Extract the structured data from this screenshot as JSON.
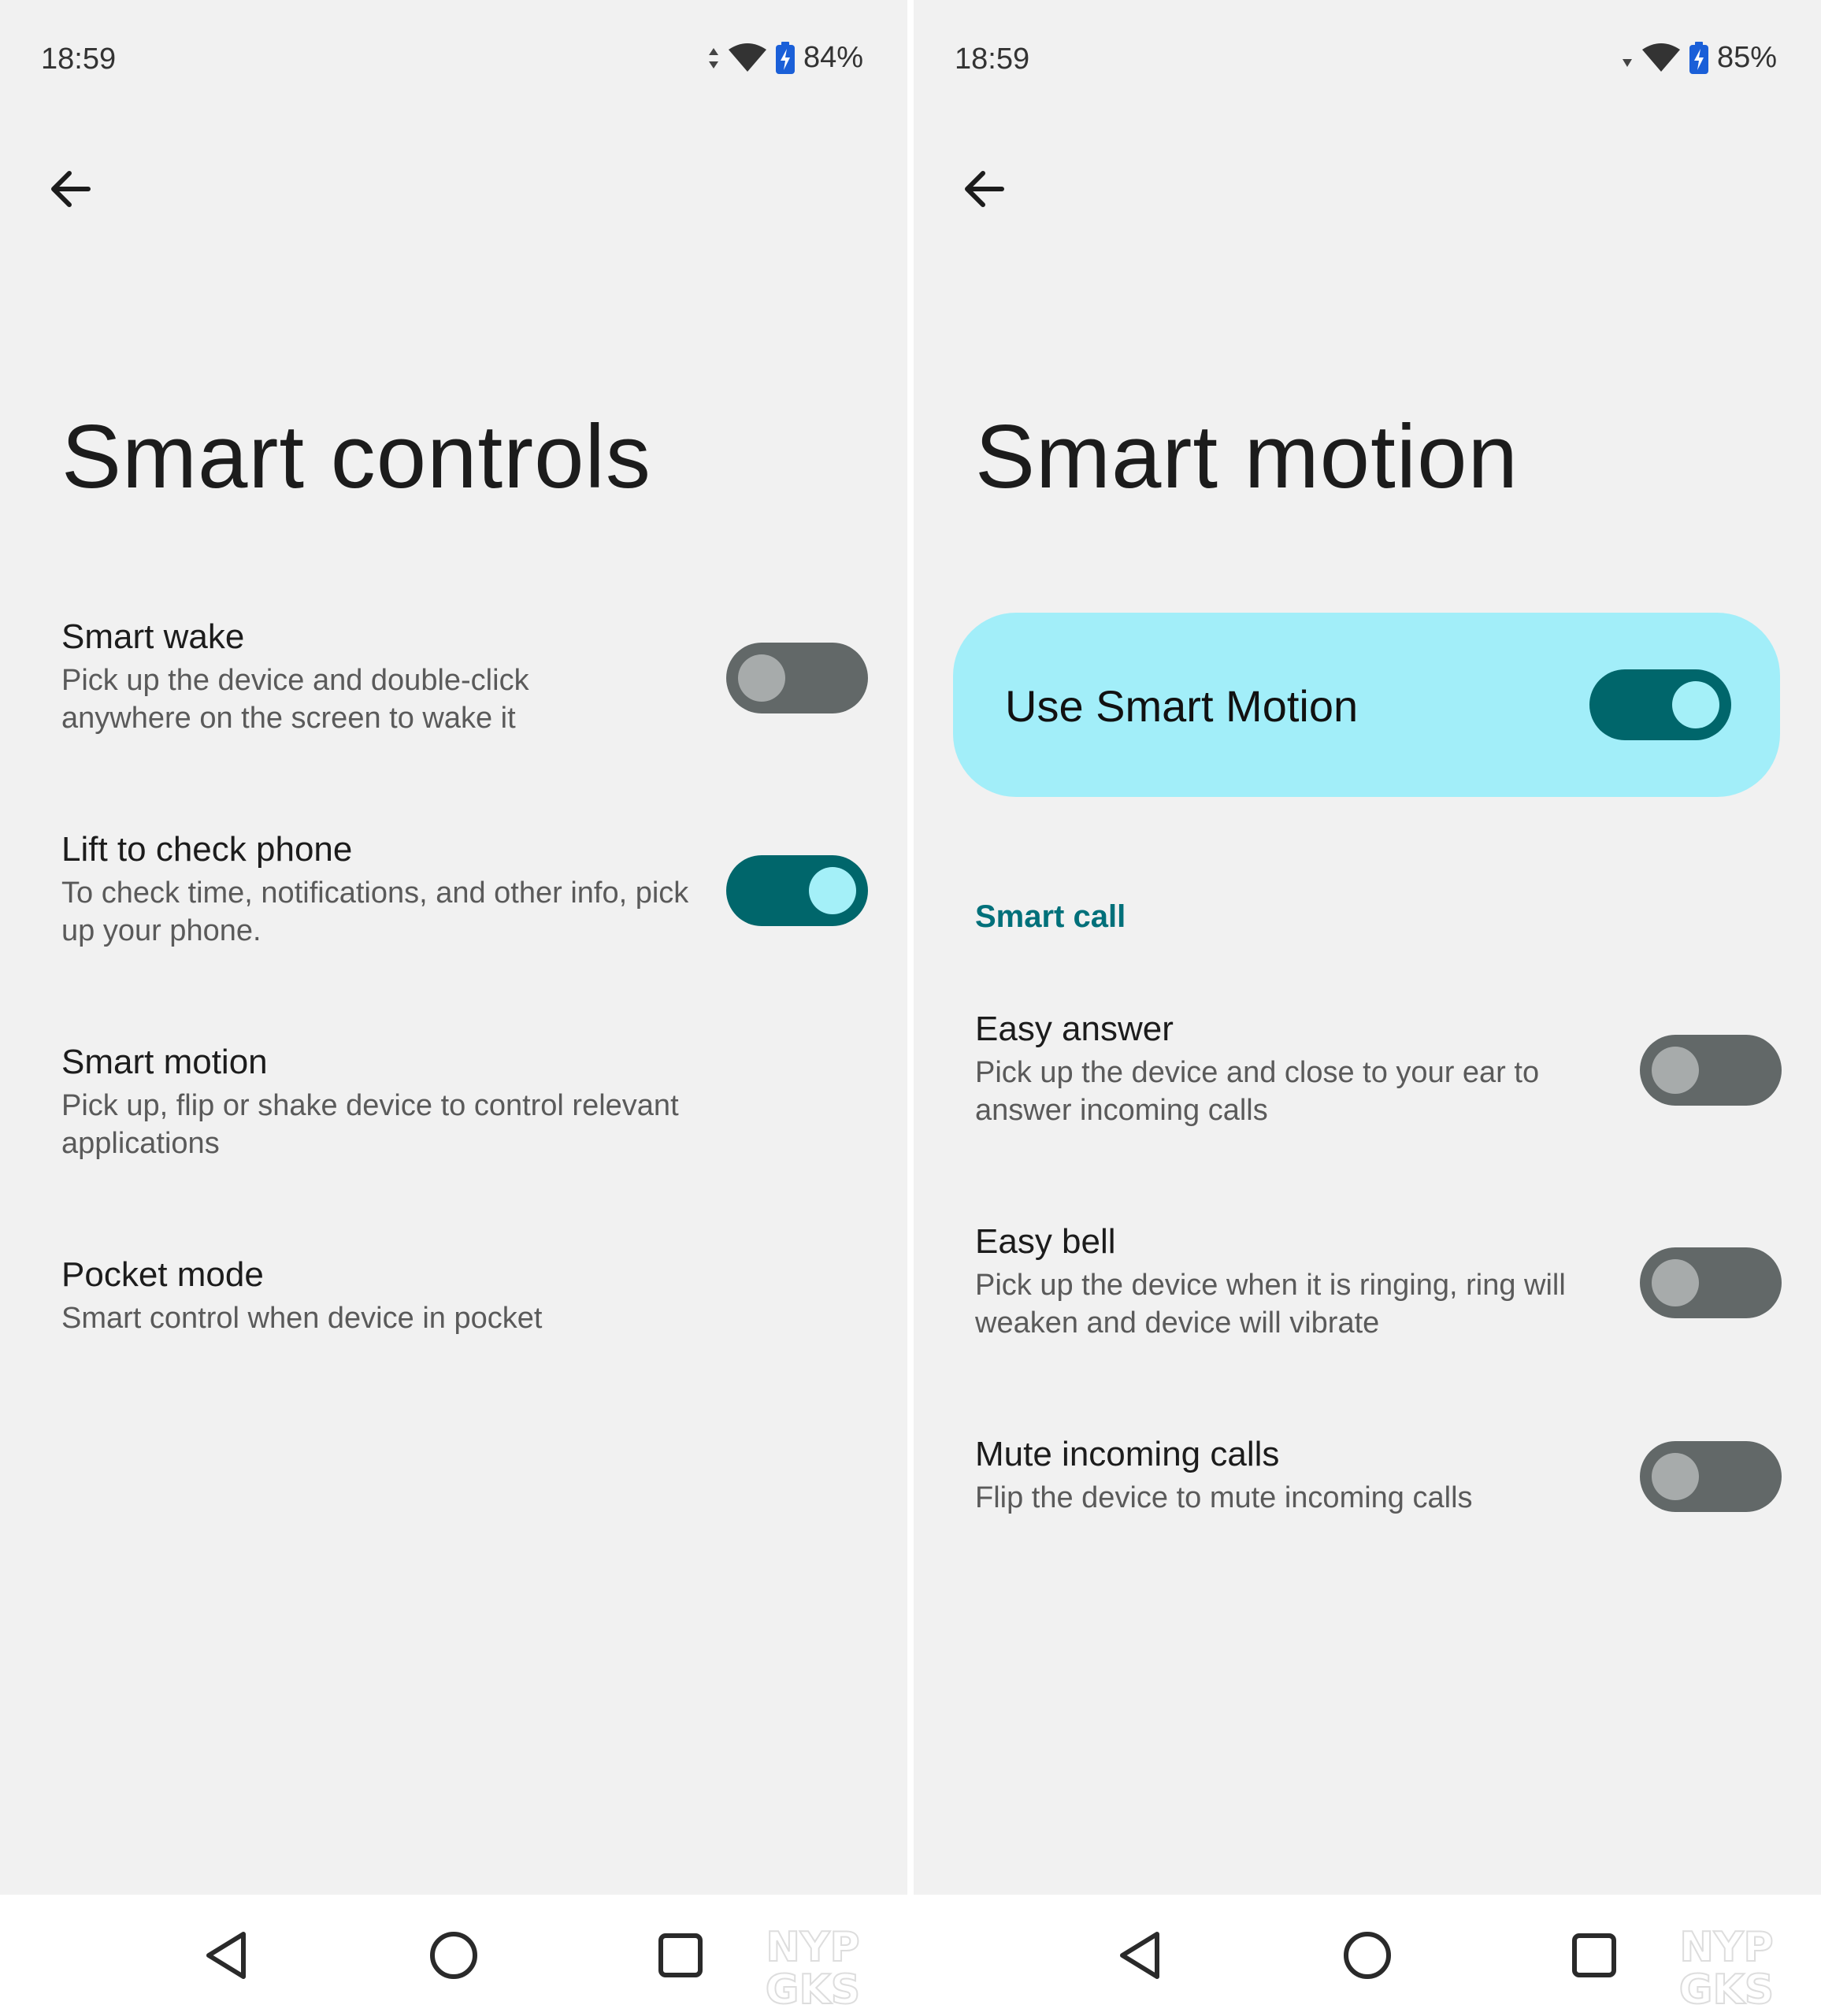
{
  "left": {
    "status": {
      "time": "18:59",
      "battery": "84%"
    },
    "title": "Smart controls",
    "settings": [
      {
        "title": "Smart wake",
        "desc": "Pick up the device and double-click anywhere on the screen to wake it",
        "toggle": "off"
      },
      {
        "title": "Lift to check phone",
        "desc": "To check time, notifications, and other info, pick up your phone.",
        "toggle": "on"
      },
      {
        "title": "Smart motion",
        "desc": "Pick up, flip or shake device to control relevant applications"
      },
      {
        "title": "Pocket mode",
        "desc": "Smart control when device in pocket"
      }
    ]
  },
  "right": {
    "status": {
      "time": "18:59",
      "battery": "85%"
    },
    "title": "Smart motion",
    "master": {
      "label": "Use Smart Motion",
      "toggle": "on"
    },
    "section": "Smart call",
    "settings": [
      {
        "title": "Easy answer",
        "desc": "Pick up the device and close to your ear to answer incoming calls",
        "toggle": "off"
      },
      {
        "title": "Easy bell",
        "desc": "Pick up the device when it is ringing, ring will weaken and device will vibrate",
        "toggle": "off"
      },
      {
        "title": "Mute incoming calls",
        "desc": "Flip the device to mute incoming calls",
        "toggle": "off"
      }
    ]
  },
  "watermark": {
    "line1": "NYP",
    "line2": "GKS"
  },
  "colors": {
    "background": "#f1f1f1",
    "accent": "#00666b",
    "toggle_off": "#626868",
    "card": "#a2eef9",
    "section_header": "#00707a"
  }
}
